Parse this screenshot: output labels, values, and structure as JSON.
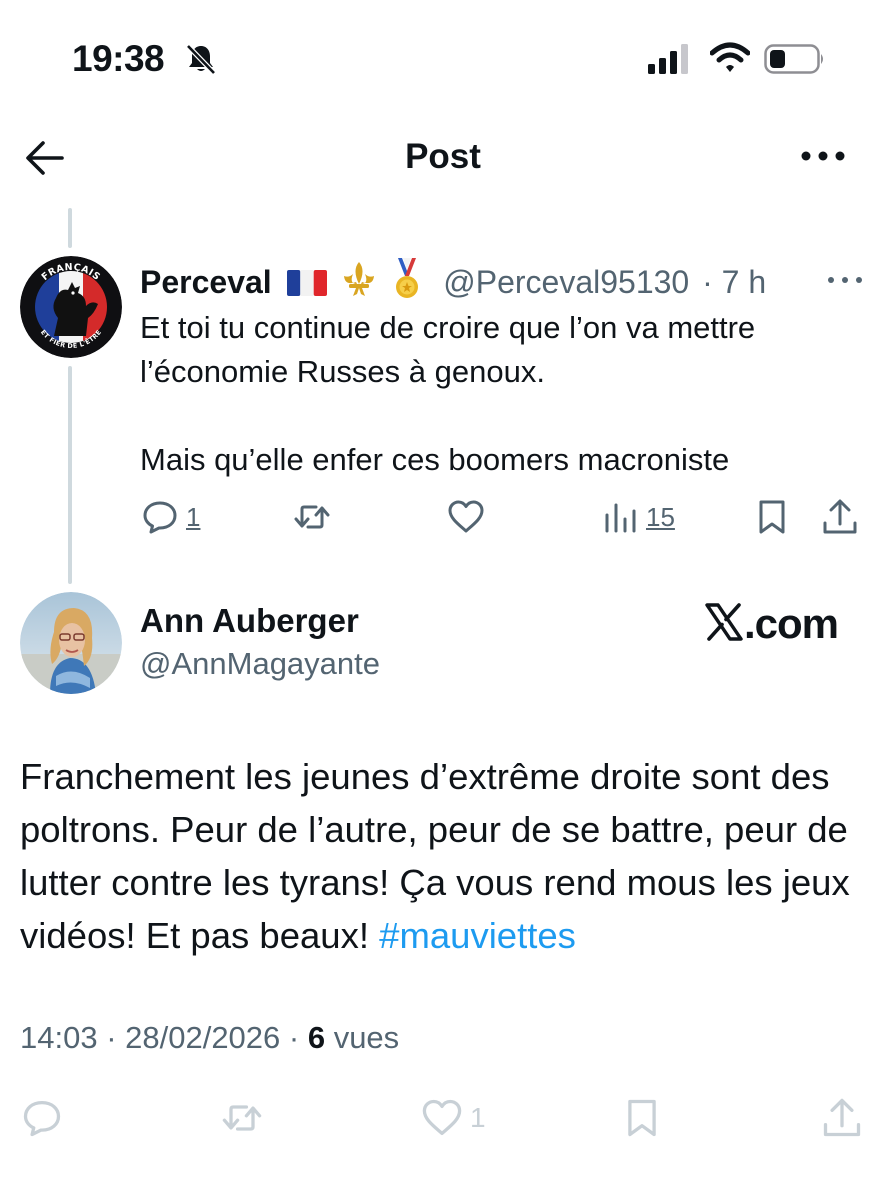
{
  "status_bar": {
    "time": "19:38",
    "icons": [
      "bell-slash-icon",
      "signal-icon",
      "wifi-icon",
      "battery-icon"
    ]
  },
  "header": {
    "title": "Post",
    "back_icon": "arrow-left-icon",
    "more_icon": "more-horizontal-icon"
  },
  "reply": {
    "author_name": "Perceval",
    "name_emojis": [
      "🇫🇷",
      "⚜️",
      "🏅"
    ],
    "handle": "@Perceval95130",
    "time": "· 7 h",
    "avatar_text_top": "FRANÇAIS",
    "avatar_text_bottom": "ET FIER DE L'ÊTRE",
    "text_lines": [
      "Et toi tu continue de croire que l’on va mettre",
      "l’économie Russes à genoux.",
      "Mais qu’elle enfer ces boomers macroniste"
    ],
    "actions": {
      "reply_count": "1",
      "retweet_count": "",
      "like_count": "",
      "views_count": "15"
    }
  },
  "post": {
    "author_name": "Ann Auberger",
    "handle": "@AnnMagayante",
    "watermark": ".com",
    "text": "Franchement les jeunes d’extrême droite sont des poltrons. Peur de l’autre, peur de se battre, peur de lutter contre les tyrans! Ça vous rend mous les jeux vidéos! Et pas beaux! ",
    "hashtag": "#mauviettes",
    "meta": {
      "time_date": "14:03 · 28/02/2026 · ",
      "views": "6",
      "views_label": " vues"
    },
    "actions": {
      "reply_count": "",
      "retweet_count": "",
      "like_count": "1"
    }
  },
  "colors": {
    "text": "#0f1419",
    "secondary": "#536471",
    "link": "#1d9bf0",
    "faded_icons": "#c8d0d6",
    "thread_line": "#cfd9de"
  }
}
